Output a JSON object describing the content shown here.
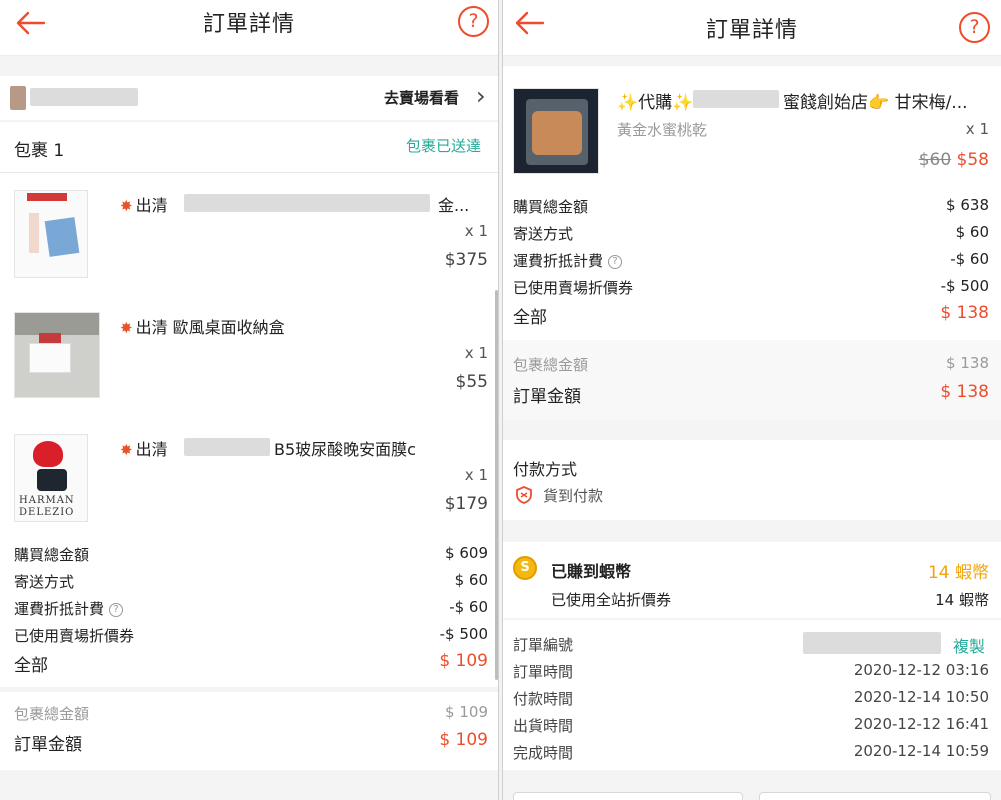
{
  "left": {
    "header": {
      "title": "訂單詳情",
      "help": "?"
    },
    "shop": {
      "link": "去賣場看看",
      "chevron": "›"
    },
    "package": {
      "label": "包裹 1",
      "status": "包裹已送達"
    },
    "items": [
      {
        "prefix": "出清",
        "suffix": "金...",
        "qty": "x 1",
        "price": "$375"
      },
      {
        "prefix": "出清 歐風桌面收納盒",
        "suffix": "",
        "qty": "x 1",
        "price": "$55"
      },
      {
        "prefix": "出清",
        "suffix": "B5玻尿酸晚安面膜c",
        "qty": "x 1",
        "price": "$179",
        "thumb_text_1": "HARMAN",
        "thumb_text_2": "DELEZIO"
      }
    ],
    "summary": {
      "rows": [
        {
          "label": "購買總金額",
          "value": "$ 609"
        },
        {
          "label": "寄送方式",
          "value": "$ 60"
        },
        {
          "label": "運費折抵計費",
          "value": "-$ 60"
        },
        {
          "label": "已使用賣場折價券",
          "value": "-$ 500"
        }
      ],
      "total_label": "全部",
      "total_value": "$ 109"
    },
    "package_total": {
      "label": "包裹總金額",
      "value": "$ 109"
    },
    "order_total": {
      "label": "訂單金額",
      "value": "$ 109"
    }
  },
  "right": {
    "header": {
      "title": "訂單詳情",
      "help": "?"
    },
    "item": {
      "name_start": "✨代購✨",
      "name_end": "蜜餞創始店👉 甘宋梅/...",
      "variant": "黃金水蜜桃乾",
      "qty": "x 1",
      "old_price": "$60",
      "price": "$58"
    },
    "summary": {
      "rows": [
        {
          "label": "購買總金額",
          "value": "$ 638"
        },
        {
          "label": "寄送方式",
          "value": "$ 60"
        },
        {
          "label": "運費折抵計費",
          "value": "-$ 60"
        },
        {
          "label": "已使用賣場折價券",
          "value": "-$ 500"
        }
      ],
      "total_label": "全部",
      "total_value": "$ 138"
    },
    "package_total": {
      "label": "包裹總金額",
      "value": "$ 138"
    },
    "order_total": {
      "label": "訂單金額",
      "value": "$ 138"
    },
    "payment": {
      "title": "付款方式",
      "method": "貨到付款"
    },
    "coins": {
      "label": "已賺到蝦幣",
      "value": "14 蝦幣",
      "sub_label": "已使用全站折價券",
      "sub_value": "14 蝦幣",
      "coin_glyph": "S"
    },
    "order_info": {
      "number_label": "訂單編號",
      "copy": "複製",
      "rows": [
        {
          "label": "訂單時間",
          "value": "2020-12-12 03:16"
        },
        {
          "label": "付款時間",
          "value": "2020-12-14 10:50"
        },
        {
          "label": "出貨時間",
          "value": "2020-12-12 16:41"
        },
        {
          "label": "完成時間",
          "value": "2020-12-14 10:59"
        }
      ]
    }
  },
  "colors": {
    "accent": "#ee4d2d",
    "teal": "#26aa99",
    "gold": "#f2a40b",
    "text": "#222222",
    "muted": "#9a9a9a"
  },
  "icons": {
    "back": "back-arrow-icon",
    "help": "help-circle-icon",
    "info": "info-circle-icon",
    "shield": "shield-icon",
    "coin": "coin-icon",
    "burst": "burst-icon"
  }
}
